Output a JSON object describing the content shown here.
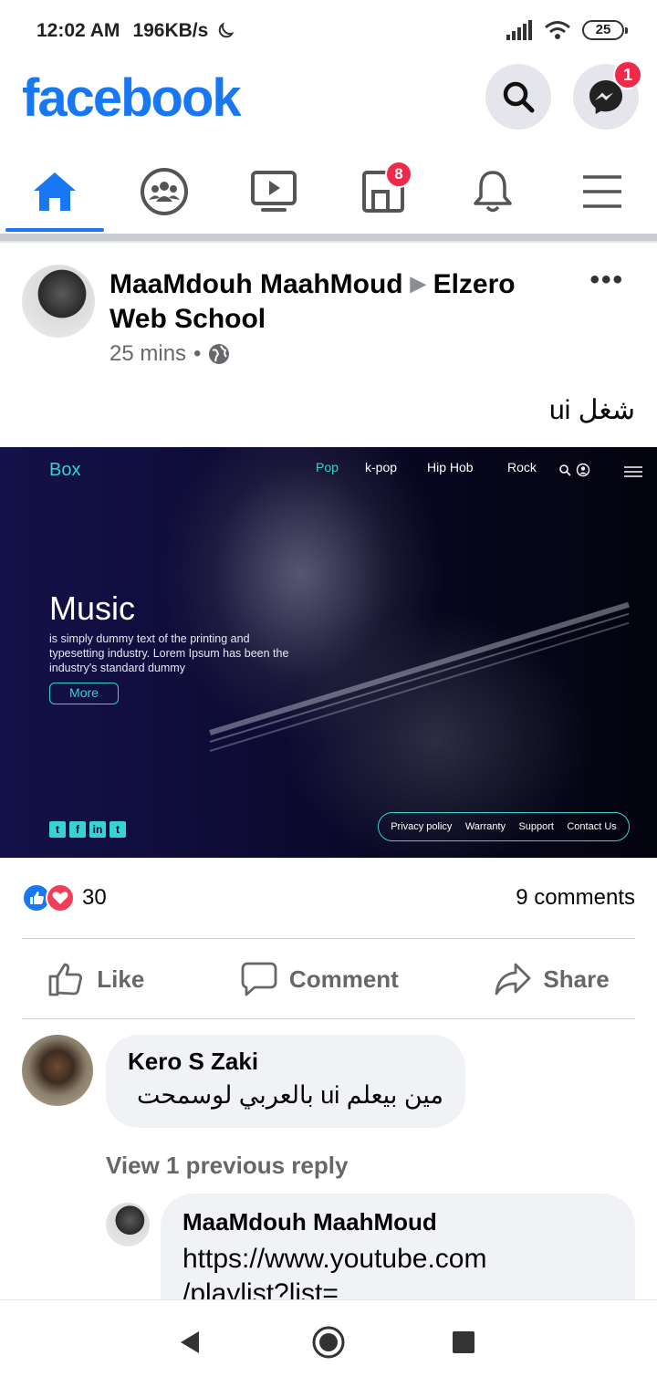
{
  "status_bar": {
    "time": "12:02 AM",
    "speed": "196KB/s",
    "battery": "25"
  },
  "header": {
    "logo": "facebook",
    "messenger_badge": "1"
  },
  "tabs": {
    "pages_badge": "8"
  },
  "post": {
    "author": "MaaMdouh MaahMoud",
    "group": "Elzero Web School",
    "time": "25 mins",
    "text": "شغل ui",
    "image": {
      "brand": "Box",
      "nav": [
        "Pop",
        "k-pop",
        "Hip Hob",
        "Rock"
      ],
      "title": "Music",
      "description": " is simply dummy text of the printing and typesetting industry. Lorem Ipsum has been the industry's standard dummy",
      "button": "More",
      "footer_links": [
        "Privacy policy",
        "Warranty",
        "Support",
        "Contact Us"
      ]
    },
    "reaction_count": "30",
    "comments_count": "9 comments",
    "actions": {
      "like": "Like",
      "comment": "Comment",
      "share": "Share"
    }
  },
  "comments": [
    {
      "name": "Kero S Zaki",
      "text": "مين بيعلم ui بالعربي لوسمحت"
    }
  ],
  "view_previous": "View 1 previous reply",
  "reply": {
    "name": "MaaMdouh MaahMoud",
    "text_line1": "https://www.youtube.com",
    "text_line2": "/playlist?list="
  },
  "colors": {
    "brand": "#1877f2",
    "badge": "#f02849",
    "accent_image": "#37d3d1"
  }
}
